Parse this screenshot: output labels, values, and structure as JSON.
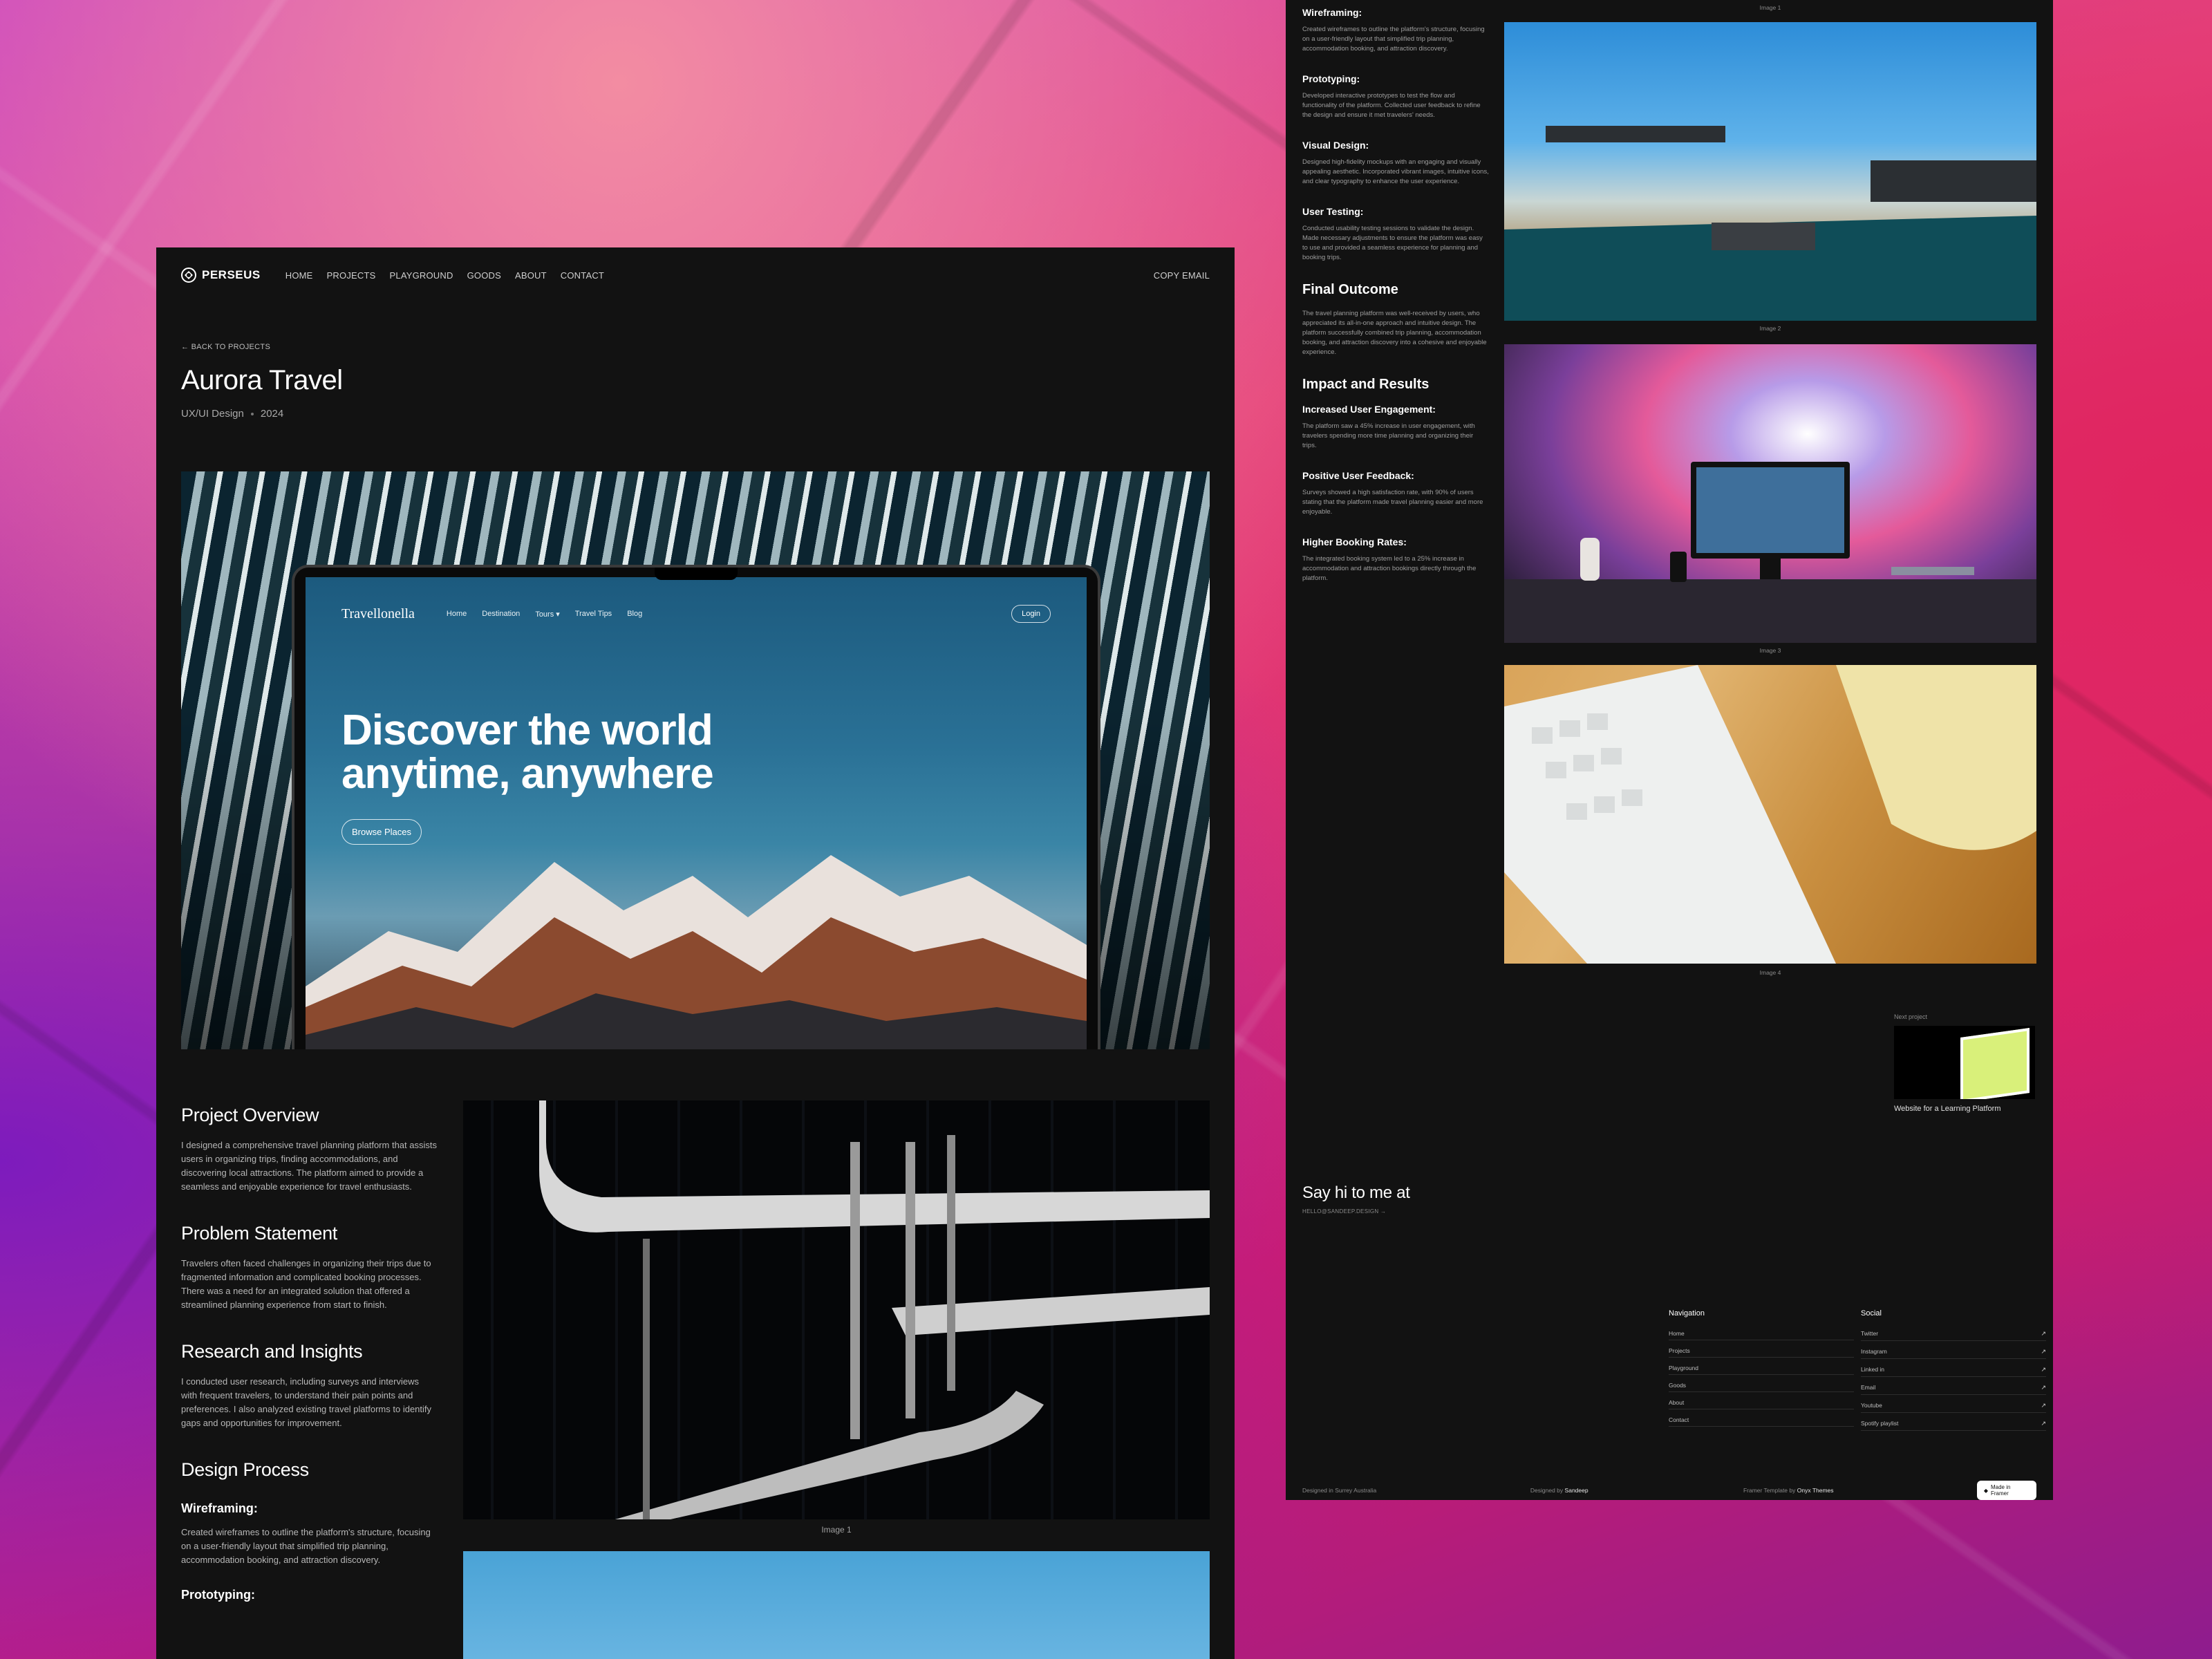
{
  "nav": {
    "logo": "PERSEUS",
    "links": [
      "HOME",
      "PROJECTS",
      "PLAYGROUND",
      "GOODS",
      "ABOUT",
      "CONTACT"
    ],
    "copy_email": "COPY EMAIL"
  },
  "project": {
    "back": "← BACK TO PROJECTS",
    "title": "Aurora Travel",
    "category": "UX/UI Design",
    "year": "2024"
  },
  "hero_site": {
    "logo": "Travellonella",
    "links": [
      "Home",
      "Destination",
      "Tours ▾",
      "Travel Tips",
      "Blog"
    ],
    "login": "Login",
    "headline_line1": "Discover the world",
    "headline_line2": "anytime, anywhere",
    "cta": "Browse Places"
  },
  "sections": {
    "overview_h": "Project Overview",
    "overview_p": "I designed a comprehensive travel planning platform that assists users in organizing trips, finding accommodations, and discovering local attractions. The platform aimed to provide a seamless and enjoyable experience for travel enthusiasts.",
    "problem_h": "Problem Statement",
    "problem_p": "Travelers often faced challenges in organizing their trips due to fragmented information and complicated booking processes. There was a need for an integrated solution that offered a streamlined planning experience from start to finish.",
    "research_h": "Research and Insights",
    "research_p": "I conducted user research, including surveys and interviews with frequent travelers, to understand their pain points and preferences. I also analyzed existing travel platforms to identify gaps and opportunities for improvement.",
    "design_h": "Design Process",
    "wire_h": "Wireframing:",
    "wire_p": "Created wireframes to outline the platform's structure, focusing on a user-friendly layout that simplified trip planning, accommodation booking, and attraction discovery.",
    "proto_h": "Prototyping:",
    "proto_p": "Developed interactive prototypes to test the flow and functionality of the platform. Collected user feedback to refine the design and ensure it met travelers' needs.",
    "visual_h": "Visual Design:",
    "visual_p": "Designed high-fidelity mockups with an engaging and visually appealing aesthetic. Incorporated vibrant images, intuitive icons, and clear typography to enhance the user experience.",
    "testing_h": "User Testing:",
    "testing_p": "Conducted usability testing sessions to validate the design. Made necessary adjustments to ensure the platform was easy to use and provided a seamless experience for planning and booking trips.",
    "final_h": "Final Outcome",
    "final_p": "The travel planning platform was well-received by users, who appreciated its all-in-one approach and intuitive design. The platform successfully combined trip planning, accommodation booking, and attraction discovery into a cohesive and enjoyable experience.",
    "impact_h": "Impact and Results",
    "engage_h": "Increased User Engagement:",
    "engage_p": "The platform saw a 45% increase in user engagement, with travelers spending more time planning and organizing their trips.",
    "feedback_h": "Positive User Feedback:",
    "feedback_p": "Surveys showed a high satisfaction rate, with 90% of users stating that the platform made travel planning easier and more enjoyable.",
    "booking_h": "Higher Booking Rates:",
    "booking_p": "The integrated booking system led to a 25% increase in accommodation and attraction bookings directly through the platform."
  },
  "captions": {
    "img1": "Image 1",
    "img2": "Image 2",
    "img3": "Image 3",
    "img4": "Image 4"
  },
  "next_project": {
    "label": "Next project",
    "title": "Website for a Learning Platform"
  },
  "contact": {
    "say_hi": "Say hi to me at",
    "email": "HELLO@SANDEEP.DESIGN  →"
  },
  "footer": {
    "nav_h": "Navigation",
    "nav_items": [
      "Home",
      "Projects",
      "Playground",
      "Goods",
      "About",
      "Contact"
    ],
    "social_h": "Social",
    "social_items": [
      "Twitter",
      "Instagram",
      "Linked in",
      "Email",
      "Youtube",
      "Spotify playlist"
    ],
    "location": "Designed in Surrey Australia",
    "designed_by": "Designed by",
    "designer": "Sandeep",
    "template_by": "Framer Template by",
    "template_author": "Onyx Themes",
    "badge": "Made in Framer"
  }
}
